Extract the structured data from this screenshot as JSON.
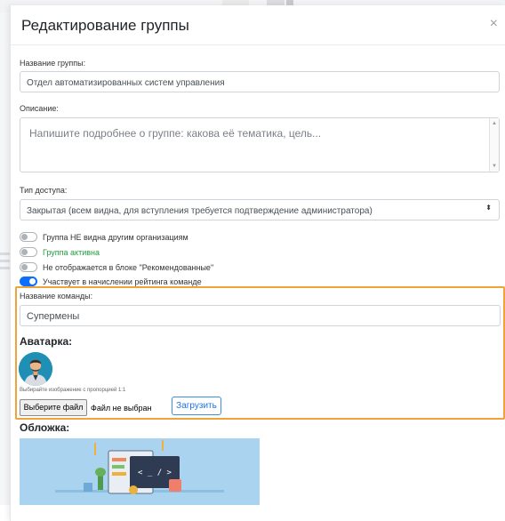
{
  "modal": {
    "title": "Редактирование группы",
    "close_label": "×"
  },
  "form": {
    "name_label": "Название группы:",
    "name_value": "Отдел автоматизированных систем управления",
    "description_label": "Описание:",
    "description_placeholder": "Напишите подробнее о группе: какова её тематика, цель...",
    "access_label": "Тип доступа:",
    "access_value": "Закрытая (всем видна, для вступления требуется подтверждение администратора)",
    "access_arrow": "⬍"
  },
  "toggles": [
    {
      "label": "Группа НЕ видна другим организациям",
      "on": false,
      "color": "#333333"
    },
    {
      "label": "Группа активна",
      "on": false,
      "color": "#1e9e3c"
    },
    {
      "label": "Не отображается в блоке \"Рекомендованные\"",
      "on": false,
      "color": "#333333"
    },
    {
      "label": "Участвует в начислении рейтинга команде",
      "on": true,
      "color": "#333333"
    }
  ],
  "team": {
    "name_label": "Название команды:",
    "name_value": "Супермены",
    "avatar_heading": "Аватарка:",
    "avatar_hint": "Выбирайте изображение с пропорцией 1:1",
    "choose_file_label": "Выберите файл",
    "no_file_label": "Файл не выбран",
    "upload_label": "Загрузить",
    "highlight_color": "#f0a33a"
  },
  "cover": {
    "heading": "Обложка:",
    "code_text": "< _ / >"
  },
  "colors": {
    "accent": "#0d6efd",
    "active_green": "#1e9e3c"
  }
}
